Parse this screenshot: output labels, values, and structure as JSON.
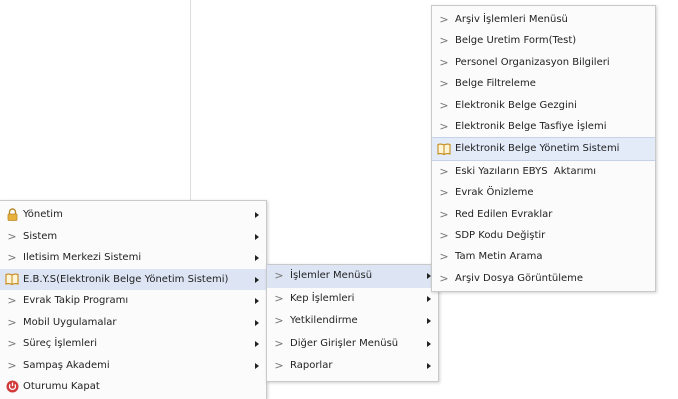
{
  "main_menu": {
    "items": [
      {
        "label": "Yönetim",
        "icon": "lock-icon",
        "submenu": true
      },
      {
        "label": "Sistem",
        "icon": "chevron-right-icon",
        "submenu": true
      },
      {
        "label": "Iletisim Merkezi Sistemi",
        "icon": "chevron-right-icon",
        "submenu": true
      },
      {
        "label": "E.B.Y.S(Elektronik Belge Yönetim Sistemi)",
        "icon": "book-icon",
        "submenu": true,
        "active": true
      },
      {
        "label": "Evrak Takip Programı",
        "icon": "chevron-right-icon",
        "submenu": true
      },
      {
        "label": "Mobil Uygulamalar",
        "icon": "chevron-right-icon",
        "submenu": true
      },
      {
        "label": "Süreç İşlemleri",
        "icon": "chevron-right-icon",
        "submenu": true
      },
      {
        "label": "Sampaş Akademi",
        "icon": "chevron-right-icon",
        "submenu": true
      },
      {
        "label": "Oturumu Kapat",
        "icon": "power-icon",
        "submenu": false
      }
    ]
  },
  "ebys_menu": {
    "items": [
      {
        "label": "İşlemler Menüsü",
        "active": true
      },
      {
        "label": "Kep İşlemleri"
      },
      {
        "label": "Yetkilendirme"
      },
      {
        "label": "Diğer Girişler Menüsü"
      },
      {
        "label": "Raporlar"
      }
    ]
  },
  "islemler_menu": {
    "items": [
      {
        "label": "Arşiv İşlemleri Menüsü",
        "icon": "chevron-right-icon"
      },
      {
        "label": "Belge Uretim Form(Test)",
        "icon": "chevron-right-icon"
      },
      {
        "label": "Personel Organizasyon Bilgileri",
        "icon": "chevron-right-icon"
      },
      {
        "label": "Belge Filtreleme",
        "icon": "chevron-right-icon"
      },
      {
        "label": "Elektronik Belge Gezgini",
        "icon": "chevron-right-icon"
      },
      {
        "label": "Elektronik Belge Tasfiye İşlemi",
        "icon": "chevron-right-icon"
      },
      {
        "label": "Elektronik Belge Yönetim Sistemi",
        "icon": "book-icon",
        "highlight": true
      },
      {
        "label": "Eski Yazıların EBYS  Aktarımı",
        "icon": "chevron-right-icon"
      },
      {
        "label": "Evrak Önizleme",
        "icon": "chevron-right-icon"
      },
      {
        "label": "Red Edilen Evraklar",
        "icon": "chevron-right-icon"
      },
      {
        "label": "SDP Kodu Değiştir",
        "icon": "chevron-right-icon"
      },
      {
        "label": "Tam Metin Arama",
        "icon": "chevron-right-icon"
      },
      {
        "label": "Arşiv Dosya Görüntüleme",
        "icon": "chevron-right-icon"
      }
    ]
  },
  "colors": {
    "active_bg": "#dde5f4",
    "lock_icon": "#e8b13c",
    "book_icon": "#c58a18",
    "power_icon": "#d23a3a"
  }
}
